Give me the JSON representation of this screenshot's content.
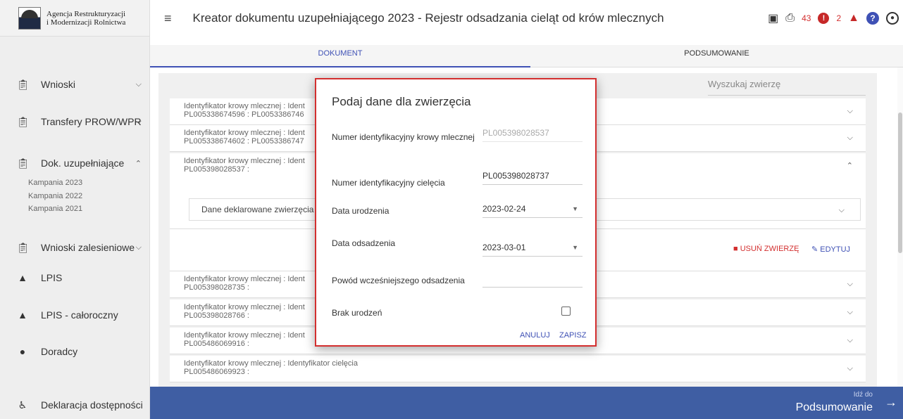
{
  "app": {
    "logo_line1": "Agencja Restrukturyzacji",
    "logo_line2": "i Modernizacji Rolnictwa",
    "title": "Kreator dokumentu uzupełniającego 2023 - Rejestr odsadzania cieląt od krów mlecznych",
    "warnings_count": "43",
    "notifications_count": "2"
  },
  "sidebar": {
    "items": [
      {
        "label": "Wnioski",
        "icon": "clipboard-icon"
      },
      {
        "label": "Transfery PROW/WPR",
        "icon": "clipboard-icon"
      },
      {
        "label": "Dok. uzupełniające",
        "icon": "clipboard-icon"
      },
      {
        "label": "Wnioski zalesieniowe",
        "icon": "clipboard-icon"
      },
      {
        "label": "LPIS",
        "icon": "mountain-icon"
      },
      {
        "label": "LPIS - całoroczny",
        "icon": "mountain-icon"
      },
      {
        "label": "Doradcy",
        "icon": "person-icon"
      },
      {
        "label": "Deklaracja dostępności",
        "icon": "accessibility-icon"
      }
    ],
    "sub_items": [
      "Kampania 2023",
      "Kampania 2022",
      "Kampania 2021"
    ]
  },
  "tabs": [
    "DOKUMENT",
    "PODSUMOWANIE"
  ],
  "content": {
    "search_placeholder": "Wyszukaj zwierzę",
    "rows": [
      {
        "line1": "Identyfikator krowy mlecznej : Ident",
        "line2": "PL005338674596 : PL0053386746"
      },
      {
        "line1": "Identyfikator krowy mlecznej : Ident",
        "line2": "PL005338674602 : PL0053386747"
      },
      {
        "line1": "Identyfikator krowy mlecznej : Ident",
        "line2": "PL005398028537 :"
      },
      {
        "line1": "Identyfikator krowy mlecznej : Ident",
        "line2": "PL005398028735 :"
      },
      {
        "line1": "Identyfikator krowy mlecznej : Ident",
        "line2": "PL005398028766 :"
      },
      {
        "line1": "Identyfikator krowy mlecznej : Ident",
        "line2": "PL005486069916 :"
      },
      {
        "line1": "Identyfikator krowy mlecznej : Identyfikator cielęcia",
        "line2": "PL005486069923 :"
      }
    ],
    "dane_label": "Dane deklarowane zwierzęcia",
    "delete_label": "USUŃ ZWIERZĘ",
    "edit_label": "EDYTUJ"
  },
  "bottom": {
    "small": "Idź do",
    "big": "Podsumowanie"
  },
  "dialog": {
    "title": "Podaj dane dla zwierzęcia",
    "fields": [
      {
        "label": "Numer identyfikacyjny krowy mlecznej",
        "value": "PL005398028537"
      },
      {
        "label": "Numer identyfikacyjny cielęcia",
        "value": "PL005398028737"
      },
      {
        "label": "Data urodzenia",
        "value": "2023-02-24"
      },
      {
        "label": "Data odsadzenia",
        "value": "2023-03-01"
      },
      {
        "label": "Powód wcześniejszego odsadzenia",
        "value": ""
      },
      {
        "label": "Brak urodzeń",
        "value": ""
      }
    ],
    "cancel_label": "ANULUJ",
    "save_label": "ZAPISZ"
  }
}
